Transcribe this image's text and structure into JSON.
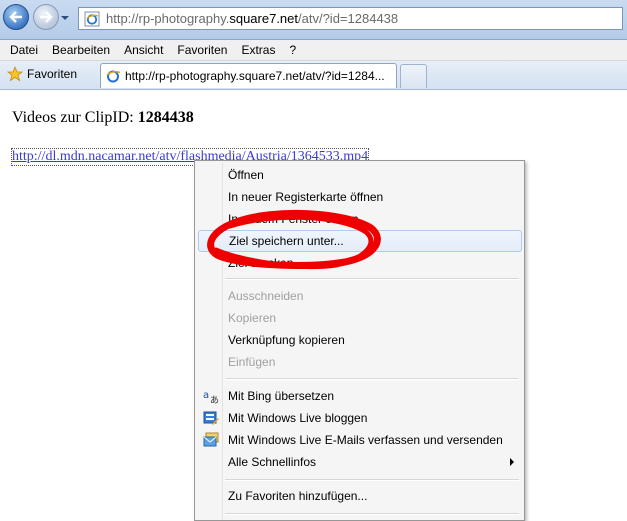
{
  "browser": {
    "url_prefix": "http://rp-photography.",
    "url_domain": "square7.net",
    "url_suffix": "/atv/?id=1284438"
  },
  "menubar": {
    "items": [
      "Datei",
      "Bearbeiten",
      "Ansicht",
      "Favoriten",
      "Extras",
      "?"
    ]
  },
  "favorites_label": "Favoriten",
  "tab": {
    "title": "http://rp-photography.square7.net/atv/?id=1284..."
  },
  "page": {
    "heading_prefix": "Videos zur ClipID: ",
    "heading_id": "1284438",
    "link_text": "http://dl.mdn.nacamar.net/atv/flashmedia/Austria/1364533.mp4"
  },
  "context_menu": {
    "items": [
      {
        "label": "Öffnen"
      },
      {
        "label": "In neuer Registerkarte öffnen"
      },
      {
        "label": "In neuem Fenster öffnen"
      },
      {
        "label": "Ziel speichern unter..."
      },
      {
        "label": "Ziel drucken"
      },
      {
        "label": "Ausschneiden"
      },
      {
        "label": "Kopieren"
      },
      {
        "label": "Verknüpfung kopieren"
      },
      {
        "label": "Einfügen"
      },
      {
        "label": "Mit Bing übersetzen",
        "icon": "translate-icon"
      },
      {
        "label": "Mit Windows Live bloggen",
        "icon": "blog-icon"
      },
      {
        "label": "Mit Windows Live E-Mails verfassen und versenden",
        "icon": "email-icon"
      },
      {
        "label": "Alle Schnellinfos",
        "icon": "submenu-arrow-icon"
      },
      {
        "label": "Zu Favoriten hinzufügen..."
      }
    ],
    "highlighted": "Ziel speichern unter...",
    "disabled": [
      "Ausschneiden",
      "Kopieren",
      "Einfügen"
    ]
  },
  "colors": {
    "annotation_red": "#ee0000",
    "link_blue": "#3a3ad8",
    "highlight_border": "#aeccf2"
  }
}
